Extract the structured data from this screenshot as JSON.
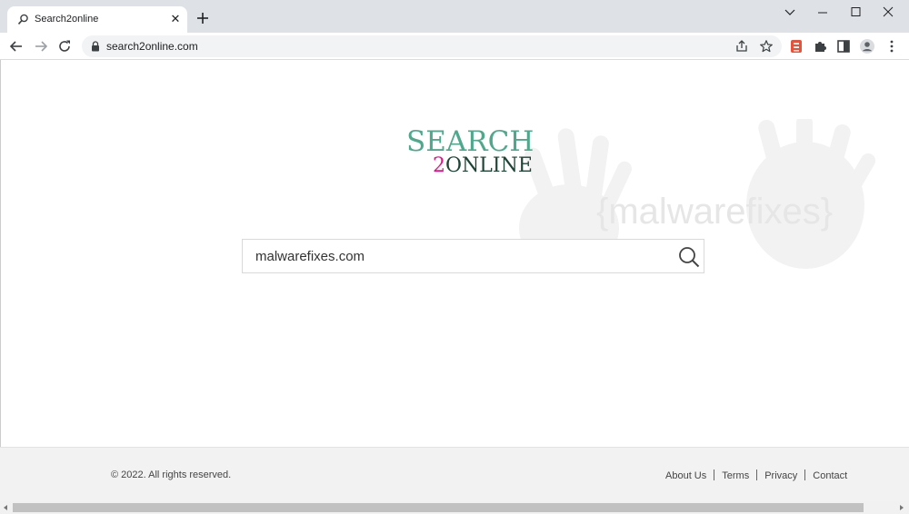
{
  "tab": {
    "title": "Search2online",
    "close_glyph": "✕"
  },
  "address_bar": {
    "url": "search2online.com"
  },
  "logo": {
    "line1": "SEARCH",
    "line2_digit": "2",
    "line2_word": "ONLINE"
  },
  "watermark": {
    "text": "{malwarefixes}"
  },
  "search": {
    "value": "malwarefixes.com"
  },
  "footer": {
    "copyright": "© 2022. All rights reserved.",
    "links": [
      "About Us",
      "Terms",
      "Privacy",
      "Contact"
    ]
  },
  "icons": {
    "tab": "search-icon",
    "toolbar": [
      "back-arrow-icon",
      "forward-arrow-icon",
      "reload-icon",
      "lock-icon",
      "share-icon",
      "star-icon",
      "extension-badge-icon",
      "puzzle-icon",
      "side-panel-icon",
      "profile-icon",
      "kebab-menu-icon"
    ],
    "search": "magnifier-icon"
  },
  "colors": {
    "tabstrip": "#dee1e6",
    "logo_green": "#4ea88c",
    "logo_dark": "#1e4436",
    "logo_pink": "#e0168a",
    "footer_bg": "#f2f2f2"
  }
}
